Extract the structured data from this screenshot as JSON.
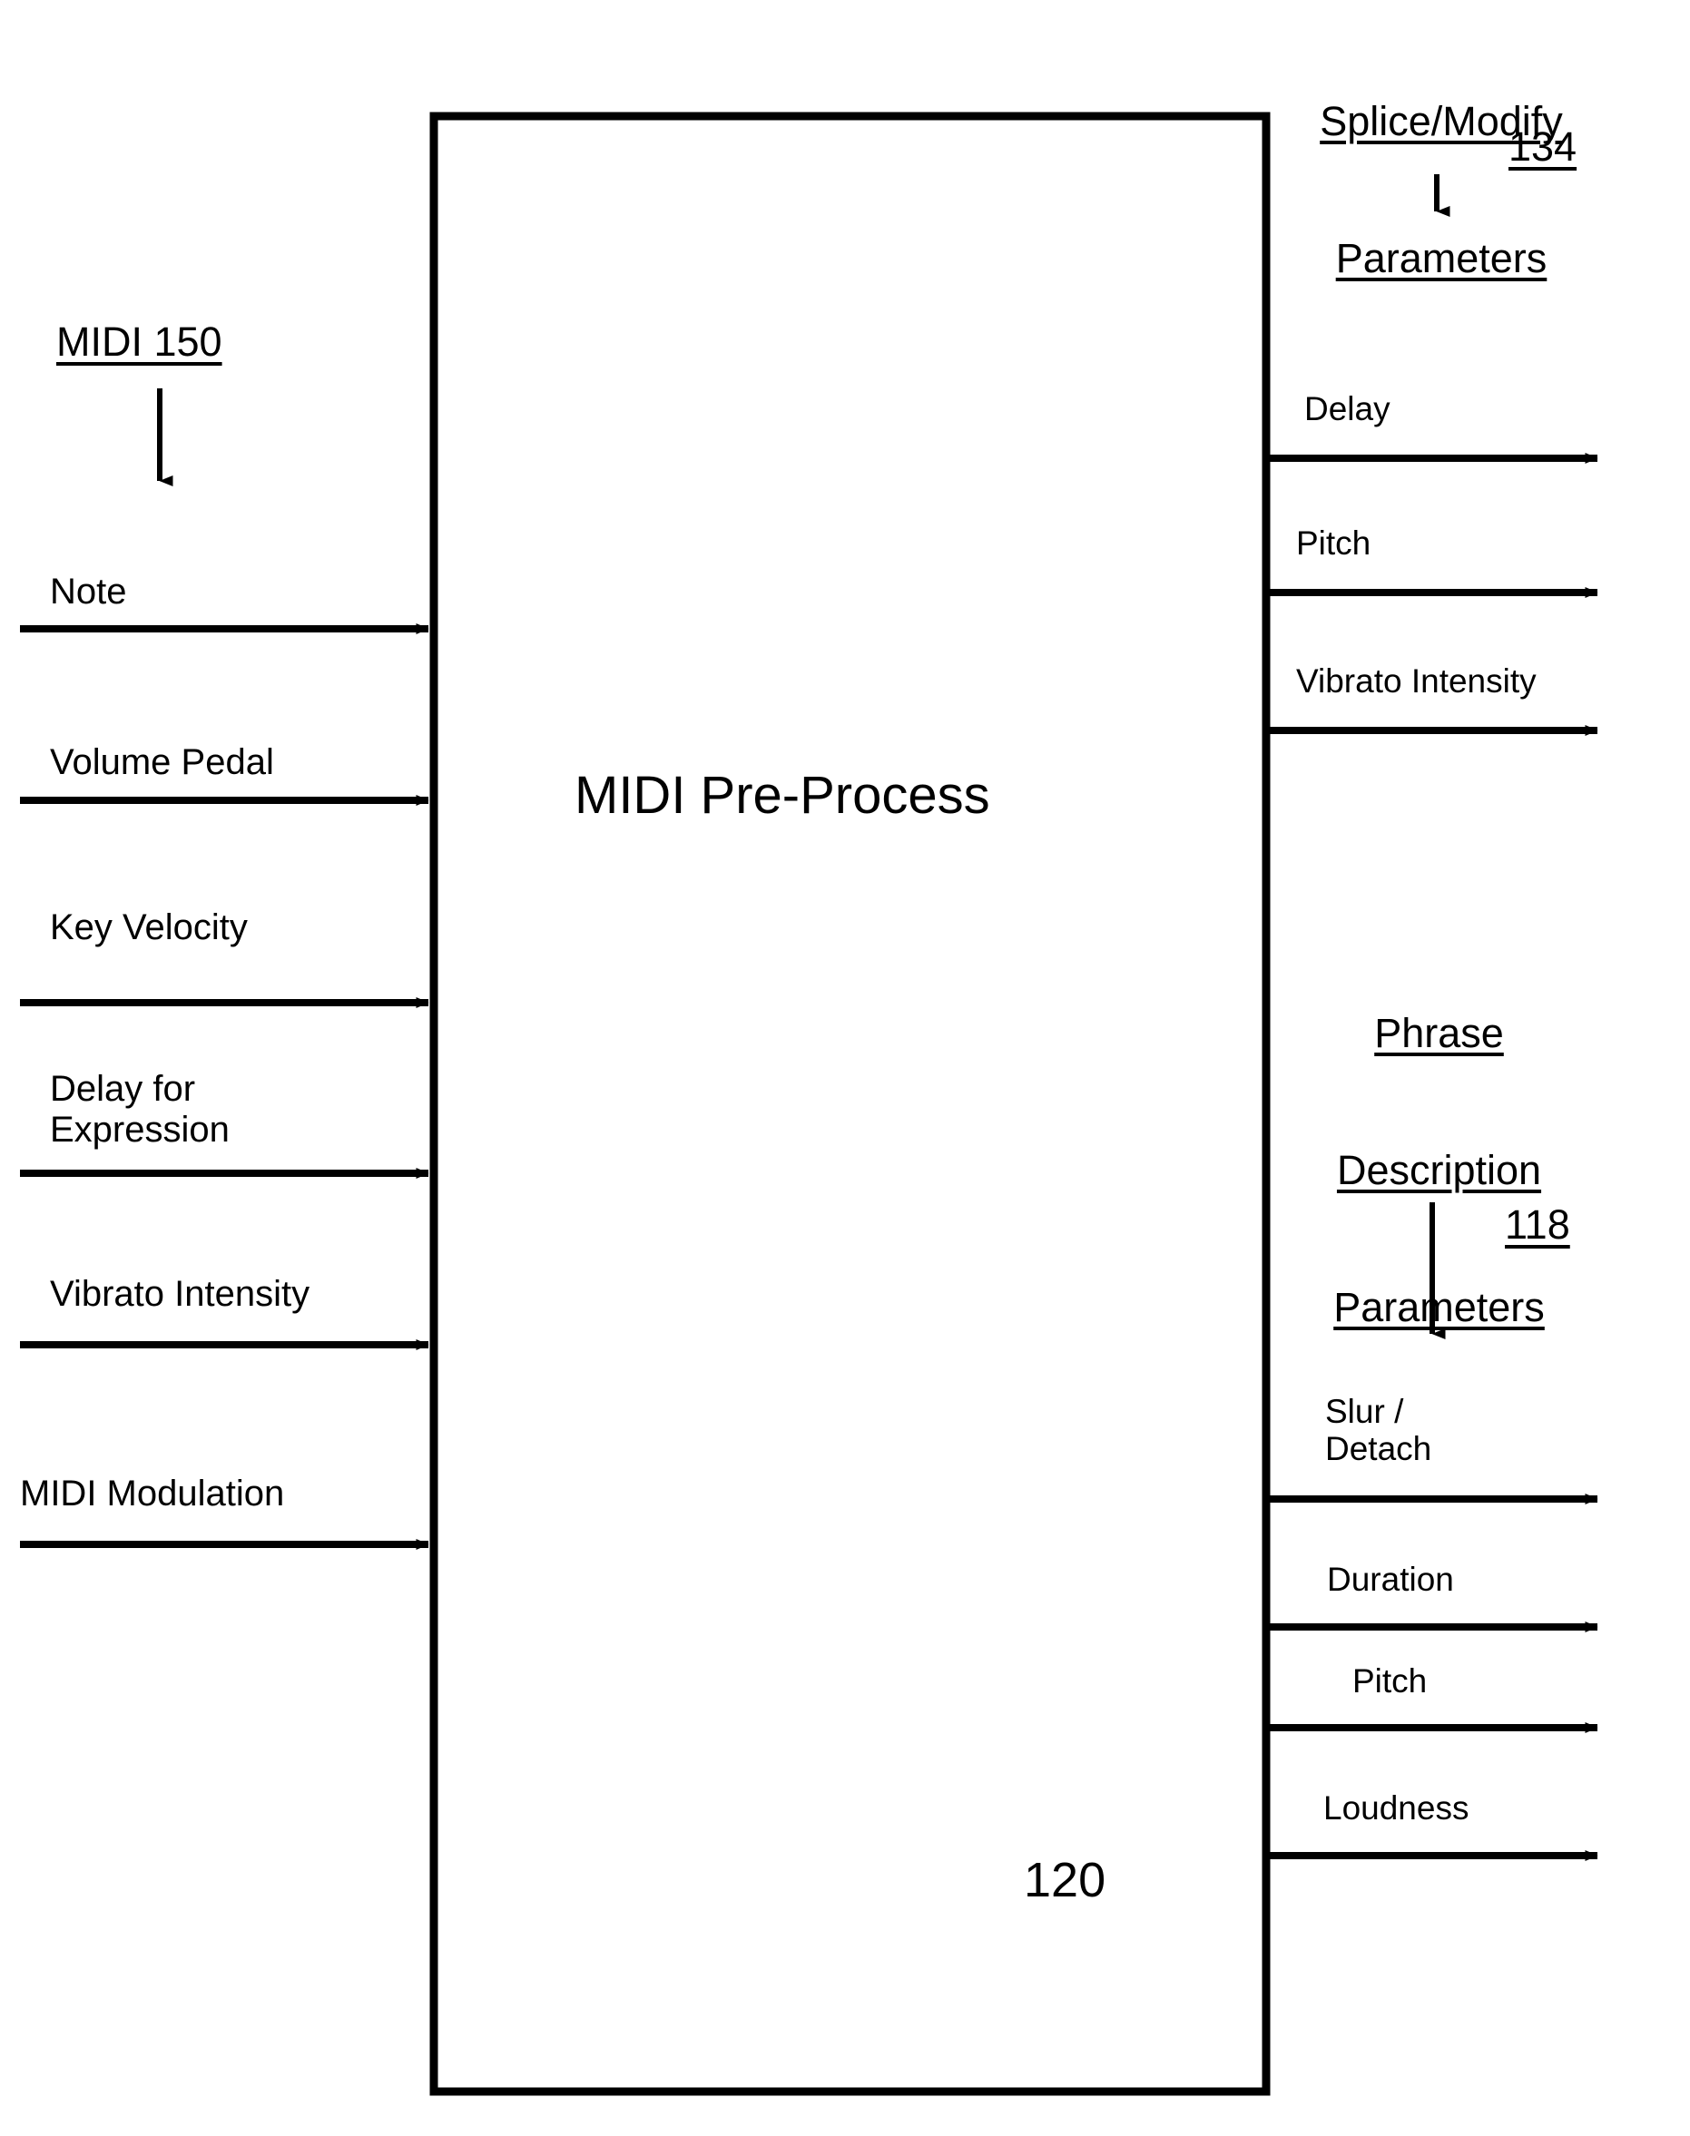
{
  "figure": {
    "box": {
      "title": "MIDI Pre-Process",
      "reference_number": "120"
    },
    "input_group": {
      "label": "MIDI 150",
      "arrow_icon": "arrow-down-icon"
    },
    "inputs": [
      {
        "label": "Note",
        "arrow_icon": "arrow-right-icon"
      },
      {
        "label": "Volume Pedal",
        "arrow_icon": "arrow-right-icon"
      },
      {
        "label": "Key Velocity",
        "arrow_icon": "arrow-right-icon"
      },
      {
        "label": "Delay for\nExpression",
        "arrow_icon": "arrow-right-icon"
      },
      {
        "label": "Vibrato Intensity",
        "arrow_icon": "arrow-right-icon"
      },
      {
        "label": "MIDI Modulation",
        "arrow_icon": "arrow-right-icon"
      }
    ],
    "output_groups": [
      {
        "title_lines": [
          "Splice/Modify",
          "Parameters"
        ],
        "reference_number": "134",
        "arrow_icon": "arrow-down-icon",
        "outputs": [
          {
            "label": "Delay",
            "arrow_icon": "arrow-right-icon"
          },
          {
            "label": "Pitch",
            "arrow_icon": "arrow-right-icon"
          },
          {
            "label": "Vibrato Intensity",
            "arrow_icon": "arrow-right-icon"
          }
        ]
      },
      {
        "title_lines": [
          "Phrase",
          "Description",
          "Parameters"
        ],
        "reference_number": "118",
        "arrow_icon": "arrow-down-icon",
        "outputs": [
          {
            "label": "Slur /\nDetach",
            "arrow_icon": "arrow-right-icon"
          },
          {
            "label": "Duration",
            "arrow_icon": "arrow-right-icon"
          },
          {
            "label": "Pitch",
            "arrow_icon": "arrow-right-icon"
          },
          {
            "label": "Loudness",
            "arrow_icon": "arrow-right-icon"
          }
        ]
      }
    ],
    "colors": {
      "ink": "#000000",
      "paper": "#ffffff"
    }
  }
}
